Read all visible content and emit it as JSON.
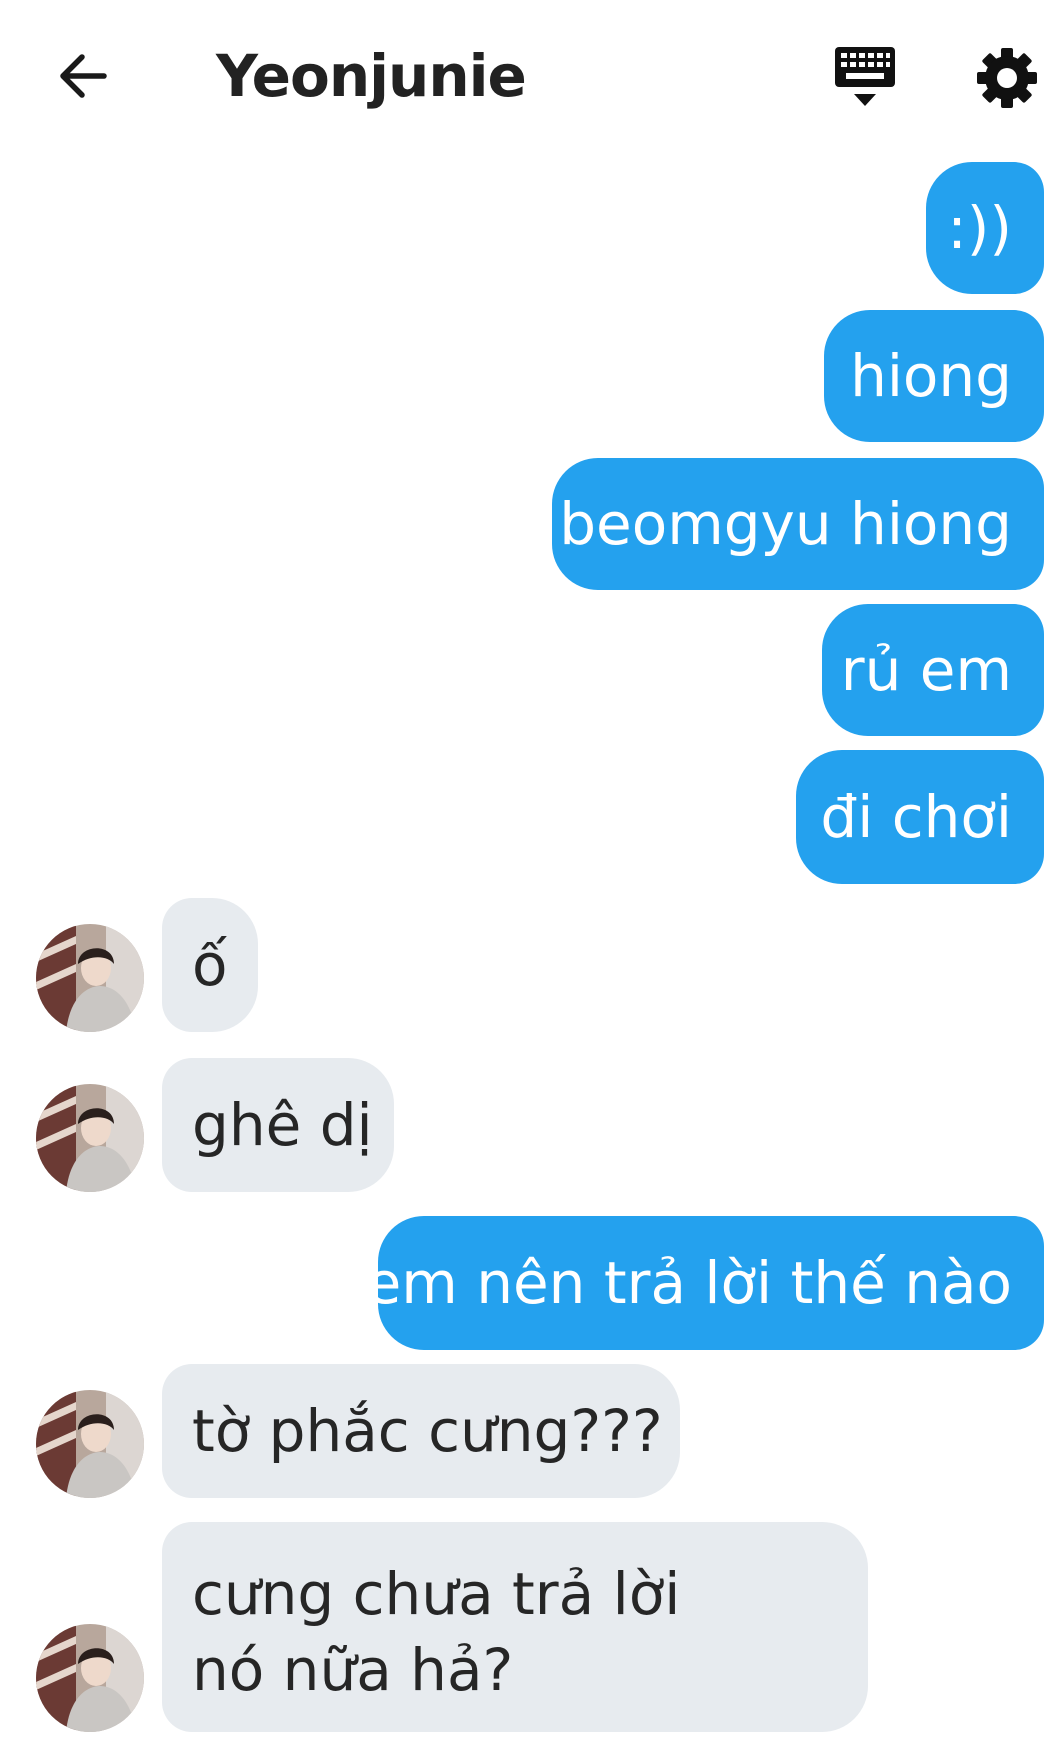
{
  "header": {
    "title": "Yeonjunie",
    "icons": {
      "back": "arrow-left-icon",
      "keyboard": "keyboard-icon",
      "settings": "gear-icon"
    }
  },
  "colors": {
    "outgoing_bubble": "#24a1ee",
    "incoming_bubble": "#e7ebef",
    "outgoing_text": "#ffffff",
    "incoming_text": "#262626"
  },
  "messages": [
    {
      "direction": "out",
      "text": ":))"
    },
    {
      "direction": "out",
      "text": "hiong"
    },
    {
      "direction": "out",
      "text": "beomgyu hiong"
    },
    {
      "direction": "out",
      "text": "rủ em"
    },
    {
      "direction": "out",
      "text": "đi chơi"
    },
    {
      "direction": "in",
      "text": "ố"
    },
    {
      "direction": "in",
      "text": "ghê dị"
    },
    {
      "direction": "out",
      "text": "em nên trả lời thế nào"
    },
    {
      "direction": "in",
      "text": "tờ phắc cưng???"
    },
    {
      "direction": "in",
      "text": "cưng chưa trả lời nó nữa hả?"
    }
  ]
}
